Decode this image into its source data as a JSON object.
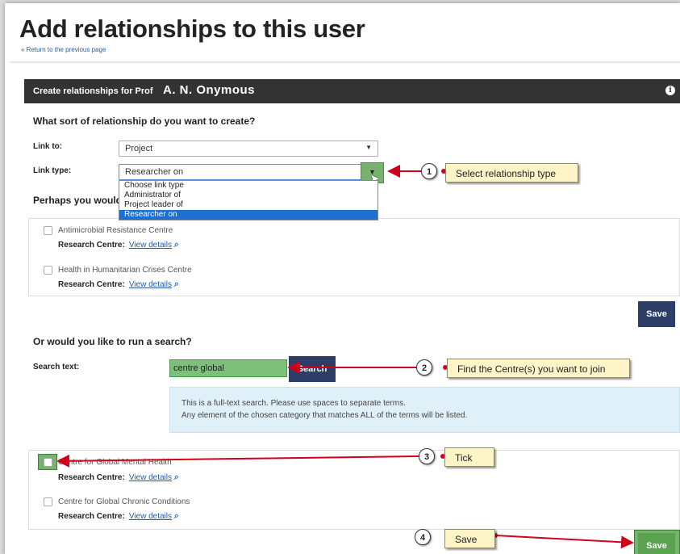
{
  "page_title": "Add relationships to this user",
  "back_link": "« Return to the previous page",
  "panel": {
    "heading": "Create relationships for Prof",
    "user_name": "A. N. Onymous",
    "info_icon": "info-icon"
  },
  "relationship": {
    "question": "What sort of relationship do you want to create?",
    "link_to_label": "Link to:",
    "link_to_value": "Project",
    "link_type_label": "Link type:",
    "link_type_value": "Researcher on",
    "link_type_options": [
      "Choose link type",
      "Administrator of",
      "Project leader of",
      "Researcher on"
    ]
  },
  "suggestions": {
    "heading": "Perhaps you would",
    "items": [
      {
        "name": "Antimicrobial Resistance Centre",
        "type_label": "Research Centre:",
        "link": "View details"
      },
      {
        "name": "Health in Humanitarian Crises Centre",
        "type_label": "Research Centre:",
        "link": "View details"
      }
    ],
    "save_label": "Save"
  },
  "search": {
    "heading": "Or would you like to run a search?",
    "label": "Search text:",
    "value": "centre global",
    "button": "Search",
    "info_line1": "This is a full-text search. Please use spaces to separate terms.",
    "info_line2": "Any element of the chosen category that matches ALL of the terms will be listed.",
    "results": [
      {
        "name": "Centre for Global Mental Health",
        "type_label": "Research Centre:",
        "link": "View details"
      },
      {
        "name": "Centre for Global Chronic Conditions",
        "type_label": "Research Centre:",
        "link": "View details"
      }
    ],
    "save_label": "Save"
  },
  "callouts": [
    {
      "num": "1",
      "text": "Select relationship type"
    },
    {
      "num": "2",
      "text": "Find the Centre(s) you want to join"
    },
    {
      "num": "3",
      "text": "Tick"
    },
    {
      "num": "4",
      "text": "Save"
    }
  ],
  "colors": {
    "header_bg": "#333333",
    "button_bg": "#2c3e66",
    "highlight": "#77b36e",
    "arrow": "#d0021b",
    "callout_bg": "#fdf4c8"
  }
}
